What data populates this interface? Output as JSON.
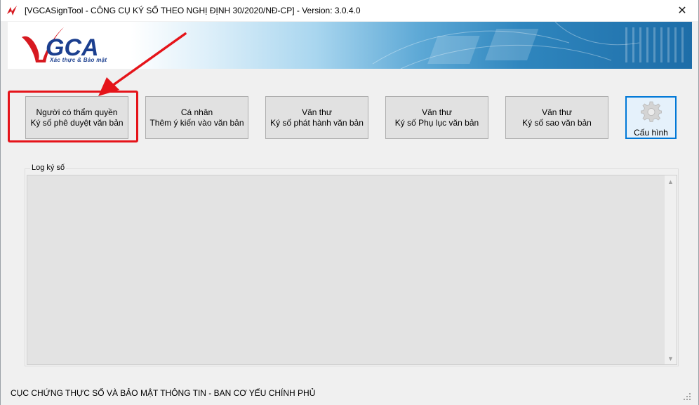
{
  "window": {
    "title": "[VGCASignTool - CÔNG CỤ KÝ SỐ THEO NGHỊ ĐỊNH 30/2020/NĐ-CP] - Version: 3.0.4.0",
    "close_icon": "close-icon"
  },
  "banner": {
    "logo_text": "VGCA",
    "logo_tagline": "Xác thực & Bảo mật"
  },
  "buttons": [
    {
      "line1": "Người có thẩm quyền",
      "line2": "Ký số phê duyệt văn bản"
    },
    {
      "line1": "Cá nhân",
      "line2": "Thêm ý kiến vào văn bản"
    },
    {
      "line1": "Văn thư",
      "line2": "Ký số phát hành văn bản"
    },
    {
      "line1": "Văn thư",
      "line2": "Ký số Phụ lục văn bản"
    },
    {
      "line1": "Văn thư",
      "line2": "Ký số sao văn bản"
    }
  ],
  "config_button": {
    "label": "Cấu hình",
    "icon": "gear-icon"
  },
  "log": {
    "label": "Log ký số",
    "content": ""
  },
  "footer": {
    "text": "CỤC CHỨNG THỰC SỐ VÀ BẢO MẬT THÔNG TIN - BAN CƠ YẾU CHÍNH PHỦ"
  },
  "colors": {
    "highlight": "#e5141a",
    "focus": "#0078d7",
    "logo_blue": "#1b3f8f",
    "logo_red": "#d71920"
  }
}
